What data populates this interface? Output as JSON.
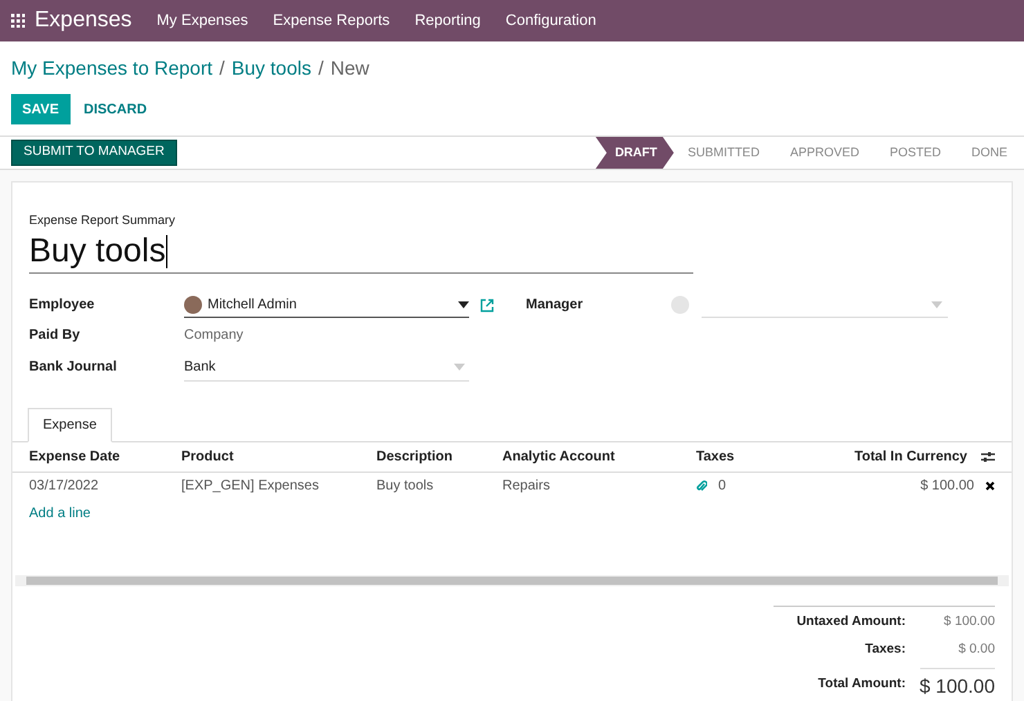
{
  "navbar": {
    "app": "Expenses",
    "menu": [
      "My Expenses",
      "Expense Reports",
      "Reporting",
      "Configuration"
    ]
  },
  "breadcrumb": {
    "links": [
      "My Expenses to Report",
      "Buy tools"
    ],
    "separators": [
      "/",
      "/"
    ],
    "current": "New"
  },
  "actions": {
    "save": "SAVE",
    "discard": "DISCARD"
  },
  "submit": "SUBMIT TO MANAGER",
  "stages": [
    {
      "label": "DRAFT",
      "selected": true
    },
    {
      "label": "SUBMITTED",
      "selected": false
    },
    {
      "label": "APPROVED",
      "selected": false
    },
    {
      "label": "POSTED",
      "selected": false
    },
    {
      "label": "DONE",
      "selected": false
    }
  ],
  "form": {
    "summary_label": "Expense Report Summary",
    "summary": "Buy tools",
    "employee_label": "Employee",
    "employee": "Mitchell Admin",
    "manager_label": "Manager",
    "paid_by_label": "Paid By",
    "paid_by": "Company",
    "journal_label": "Bank Journal",
    "journal": "Bank"
  },
  "tabs": [
    {
      "label": "Expense",
      "selected": true
    }
  ],
  "table": {
    "columns": [
      "Expense Date",
      "Product",
      "Description",
      "Analytic Account",
      "Taxes",
      "Total In Currency"
    ],
    "rows": [
      {
        "date": "03/17/2022",
        "product": "[EXP_GEN] Expenses",
        "description": "Buy tools",
        "account": "Repairs",
        "attachments": "0",
        "total": "$ 100.00"
      }
    ],
    "add_line": "Add a line"
  },
  "totals": [
    {
      "label": "Untaxed Amount:",
      "value": "$ 100.00",
      "kind": "normal"
    },
    {
      "label": "Taxes:",
      "value": "$ 0.00",
      "kind": "normal"
    },
    {
      "label": "Total Amount:",
      "value": "$ 100.00",
      "kind": "grand"
    }
  ]
}
